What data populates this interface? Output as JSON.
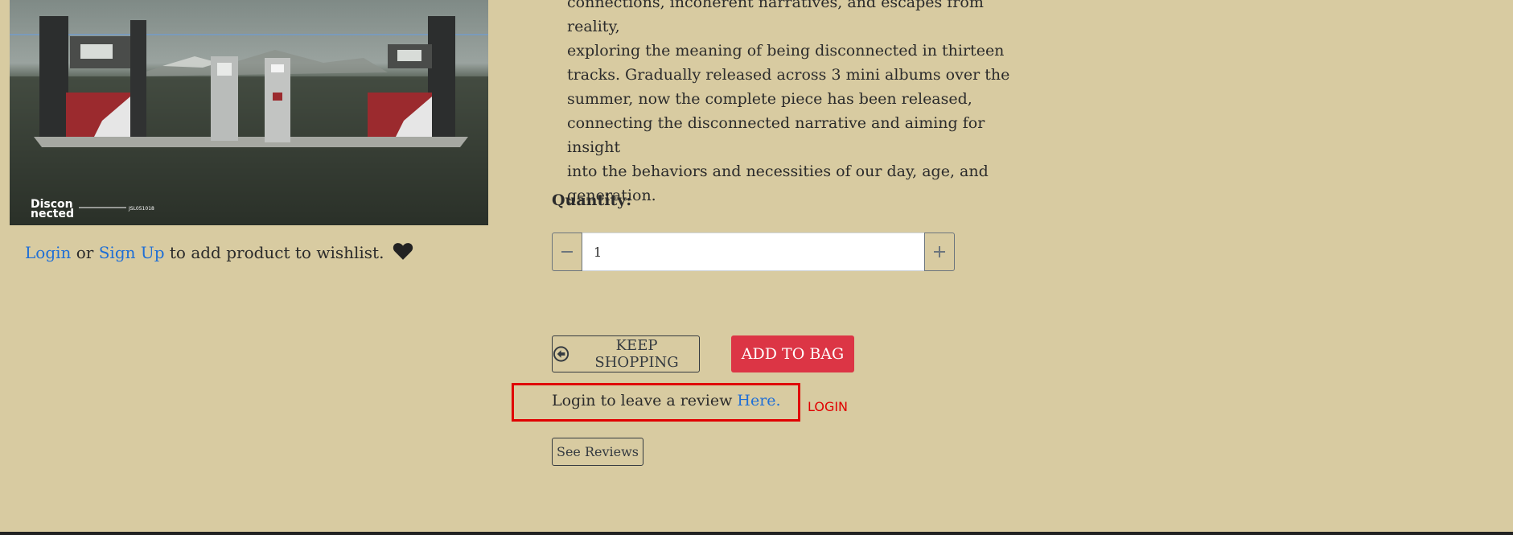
{
  "product_image": {
    "alt": "Disconnected album cover",
    "cover_title_line1": "Discon",
    "cover_title_line2": "nected",
    "cover_code": "JSL051018"
  },
  "wishlist": {
    "login_link": "Login",
    "or_text": " or ",
    "signup_link": "Sign Up",
    "suffix": " to add product to wishlist.",
    "icon": "heart-icon"
  },
  "description": {
    "lines": [
      "connections, incoherent narratives, and escapes from reality,",
      "exploring the meaning of being disconnected in thirteen",
      "tracks. Gradually released across 3 mini albums over the",
      "summer, now the complete piece has been released,",
      "connecting the disconnected narrative and aiming for insight",
      "into the behaviors and necessities of our day, age, and",
      "generation."
    ]
  },
  "quantity": {
    "label": "Quantity:",
    "value": "1",
    "minus_icon": "minus-icon",
    "plus_icon": "plus-icon"
  },
  "actions": {
    "keep_shopping_label": "KEEP SHOPPING",
    "keep_shopping_icon": "arrow-circle-left-icon",
    "add_to_bag_label": "ADD TO BAG"
  },
  "review": {
    "prefix": "Login to leave a review ",
    "link": "Here.",
    "annotation": "LOGIN",
    "see_reviews_label": "See Reviews"
  },
  "colors": {
    "background": "#d8cba1",
    "link": "#1f6fd6",
    "danger": "#dc3545",
    "annotation": "#e00000"
  }
}
